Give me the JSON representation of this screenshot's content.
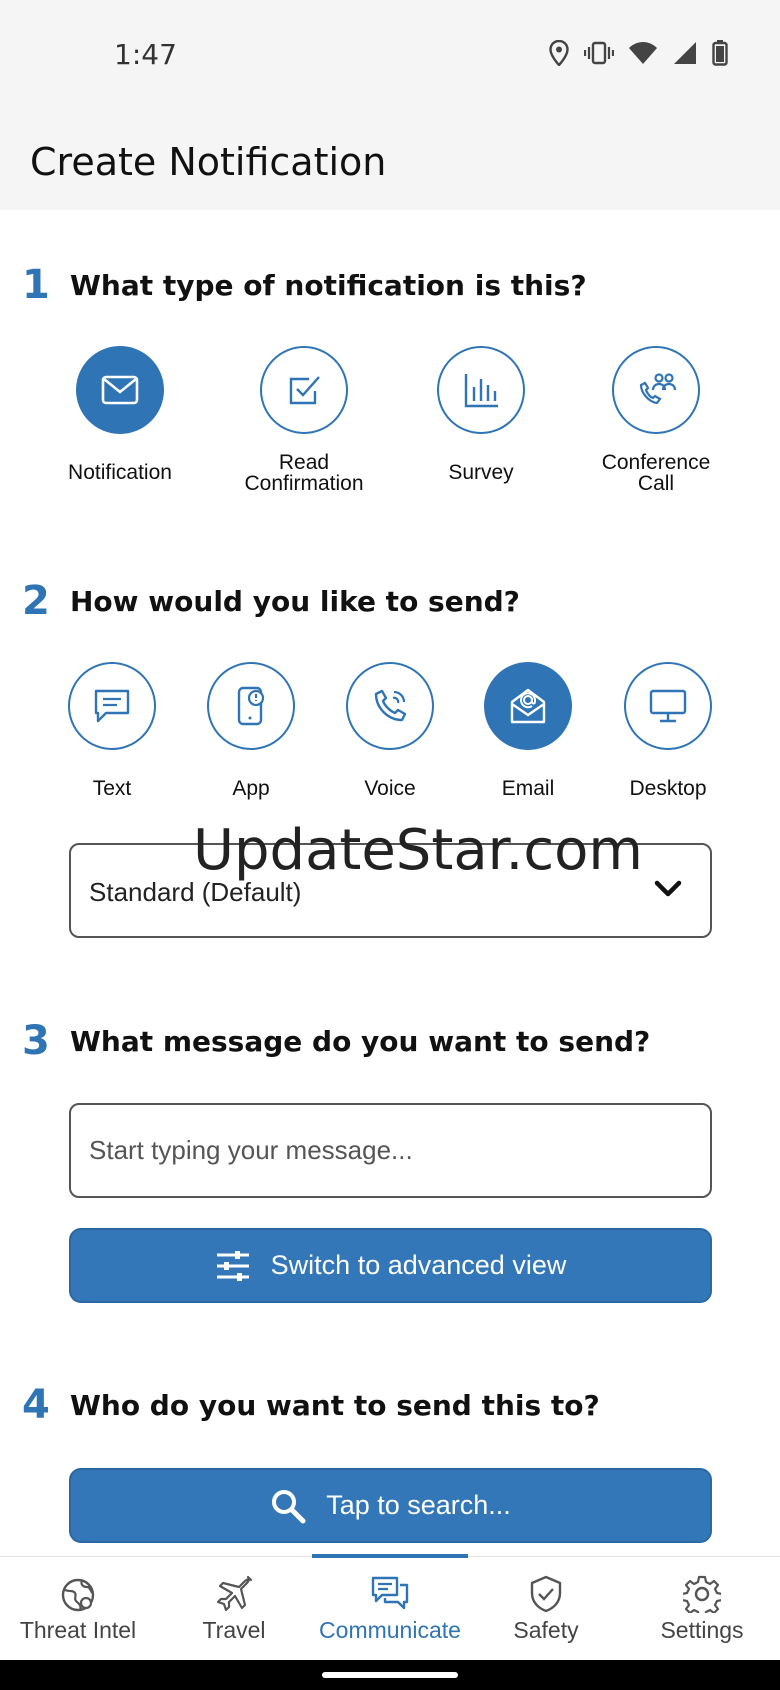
{
  "status": {
    "time": "1:47"
  },
  "header": {
    "title": "Create Notification"
  },
  "watermark": "UpdateStar.com",
  "step1": {
    "num": "1",
    "question": "What type of notification is this?",
    "options": [
      {
        "line1": "Notification",
        "line2": "",
        "icon": "envelope-icon",
        "selected": true
      },
      {
        "line1": "Read",
        "line2": "Confirmation",
        "icon": "checkbox-icon",
        "selected": false
      },
      {
        "line1": "Survey",
        "line2": "",
        "icon": "bar-chart-icon",
        "selected": false
      },
      {
        "line1": "Conference",
        "line2": "Call",
        "icon": "conference-call-icon",
        "selected": false
      }
    ]
  },
  "step2": {
    "num": "2",
    "question": "How would you like to send?",
    "options": [
      {
        "label": "Text",
        "icon": "chat-bubble-icon",
        "selected": false
      },
      {
        "label": "App",
        "icon": "phone-alert-icon",
        "selected": false
      },
      {
        "label": "Voice",
        "icon": "phone-call-icon",
        "selected": false
      },
      {
        "label": "Email",
        "icon": "email-at-icon",
        "selected": true
      },
      {
        "label": "Desktop",
        "icon": "monitor-icon",
        "selected": false
      }
    ],
    "dropdown_value": "Standard (Default)"
  },
  "step3": {
    "num": "3",
    "question": "What message do you want to send?",
    "placeholder": "Start typing your message...",
    "advanced_button": "Switch to advanced view"
  },
  "step4": {
    "num": "4",
    "question": "Who do you want to send this to?",
    "search_button": "Tap to search..."
  },
  "tabs": [
    {
      "label": "Threat Intel",
      "icon": "globe-icon",
      "active": false
    },
    {
      "label": "Travel",
      "icon": "airplane-icon",
      "active": false
    },
    {
      "label": "Communicate",
      "icon": "chat-bubbles-icon",
      "active": true
    },
    {
      "label": "Safety",
      "icon": "shield-check-icon",
      "active": false
    },
    {
      "label": "Settings",
      "icon": "gear-icon",
      "active": false
    }
  ],
  "colors": {
    "accent": "#2f74b5",
    "button": "#3377b8"
  }
}
